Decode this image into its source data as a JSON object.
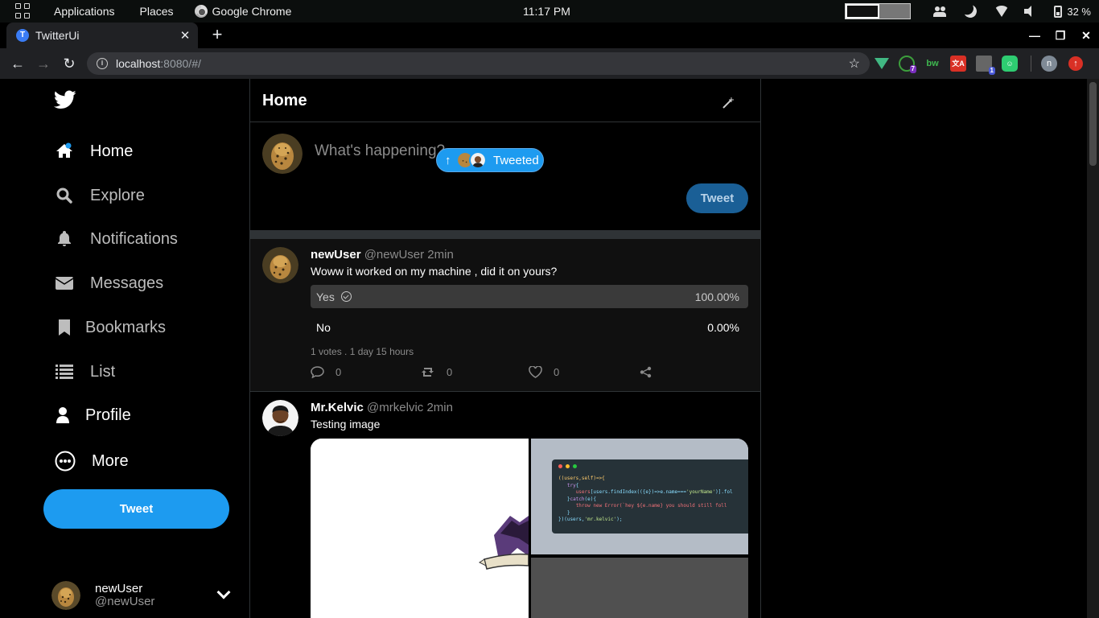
{
  "os_bar": {
    "applications": "Applications",
    "places": "Places",
    "active_app": "Google Chrome",
    "clock": "11:17 PM",
    "battery": "32 %"
  },
  "browser": {
    "tab_title": "TwitterUi",
    "tab_favicon": "T",
    "url_host": "localhost",
    "url_path": ":8080/#/",
    "ext_node_badge": "7",
    "ext_bw": "bw",
    "ext_box_badge": "1",
    "profile_initial": "n"
  },
  "sidebar": {
    "items": [
      {
        "label": "Home",
        "icon": "home-icon"
      },
      {
        "label": "Explore",
        "icon": "search-icon"
      },
      {
        "label": "Notifications",
        "icon": "bell-icon"
      },
      {
        "label": "Messages",
        "icon": "envelope-icon"
      },
      {
        "label": "Bookmarks",
        "icon": "bookmark-icon"
      },
      {
        "label": "List",
        "icon": "list-icon"
      },
      {
        "label": "Profile",
        "icon": "user-icon"
      },
      {
        "label": "More",
        "icon": "more-icon"
      }
    ],
    "tweet_button": "Tweet",
    "account": {
      "name": "newUser",
      "handle": "@newUser"
    }
  },
  "main": {
    "title": "Home",
    "composer": {
      "placeholder": "What's happening?",
      "toast": "Tweeted",
      "submit": "Tweet"
    },
    "tweets": [
      {
        "name": "newUser",
        "handle": "@newUser",
        "time": "2min",
        "text": "Woww it worked on my machine , did it on yours?",
        "poll": [
          {
            "label": "Yes",
            "percent": "100.00%"
          },
          {
            "label": "No",
            "percent": "0.00%"
          }
        ],
        "poll_meta": "1 votes . 1 day 15 hours",
        "replies": "0",
        "retweets": "0",
        "likes": "0"
      },
      {
        "name": "Mr.Kelvic",
        "handle": "@mrkelvic",
        "time": "2min",
        "text": "Testing image"
      }
    ]
  },
  "colors": {
    "accent": "#1d9bf0",
    "background": "#000000",
    "border": "#2f3336"
  }
}
